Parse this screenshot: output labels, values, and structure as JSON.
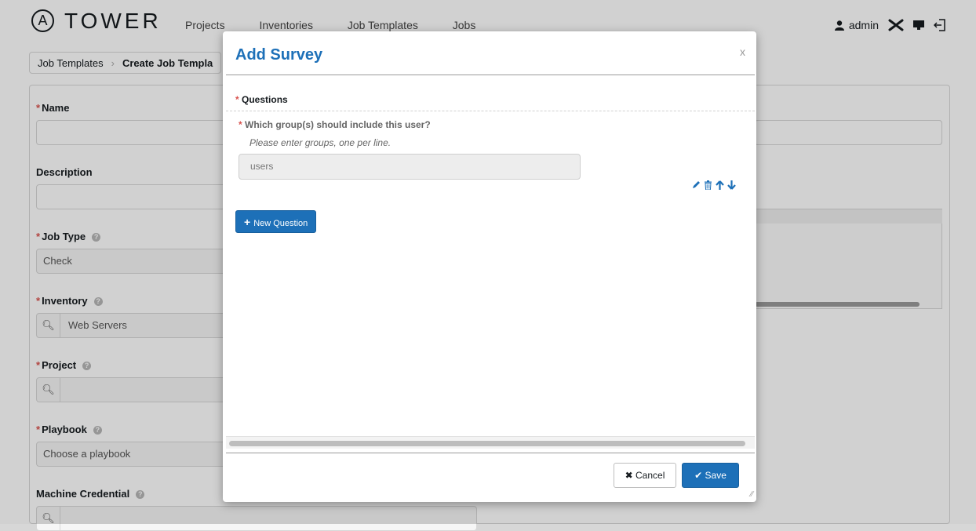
{
  "nav": {
    "logo_mark": "A",
    "logo_text": "TOWER",
    "links": [
      "Projects",
      "Inventories",
      "Job Templates",
      "Jobs"
    ],
    "user": "admin"
  },
  "breadcrumb": {
    "parent": "Job Templates",
    "current": "Create Job Templa"
  },
  "form": {
    "name_label": "Name",
    "description_label": "Description",
    "job_type_label": "Job Type",
    "job_type_value": "Check",
    "inventory_label": "Inventory",
    "inventory_value": "Web Servers",
    "project_label": "Project",
    "playbook_label": "Playbook",
    "playbook_placeholder": "Choose a playbook",
    "machine_credential_label": "Machine Credential"
  },
  "modal": {
    "title": "Add Survey",
    "close": "x",
    "questions_label": "Questions",
    "question": {
      "text": "Which group(s) should include this user?",
      "description": "Please enter groups, one per line.",
      "value": "users"
    },
    "new_question_label": "New Question",
    "cancel_label": "Cancel",
    "save_label": "Save"
  },
  "colors": {
    "accent": "#1d70b8",
    "required": "#d9534f"
  }
}
